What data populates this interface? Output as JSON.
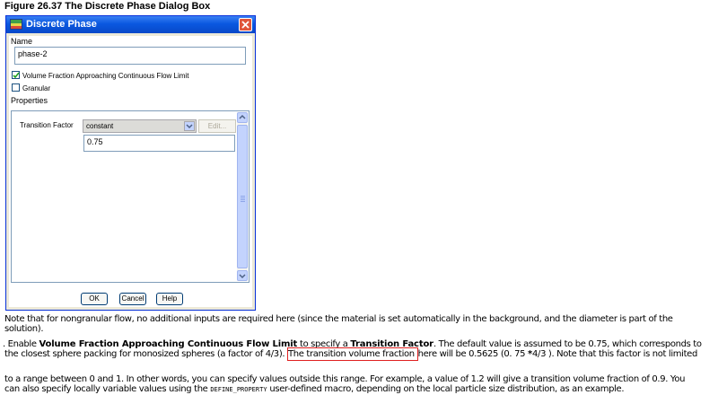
{
  "caption": "Figure 26.37  The Discrete Phase Dialog Box",
  "dialog": {
    "title": "Discrete Phase",
    "name_label": "Name",
    "name_value": "phase-2",
    "vf_checkbox_label": "Volume Fraction Approaching Continuous Flow Limit",
    "vf_checked": true,
    "granular_label": "Granular",
    "granular_checked": false,
    "properties_label": "Properties",
    "transition_factor_label": "Transition Factor",
    "method_value": "constant",
    "edit_label": "Edit...",
    "factor_value": "0.75",
    "ok_label": "OK",
    "cancel_label": "Cancel",
    "help_label": "Help"
  },
  "body": {
    "p1_line1": "Note that for nongranular flow, no additional inputs are required here (since the material is set automatically in the background, and the diameter is part of the",
    "p1_line2": "solution).",
    "p2_prefix": ". Enable ",
    "p2_bold1": "Volume Fraction Approaching Continuous Flow Limit",
    "p2_mid": " to specify a ",
    "p2_bold2": "Transition Factor",
    "p2_rest": ". The default value is assumed to be 0.75, which corresponds to",
    "p2_line2_a": "the closest sphere packing for monosized spheres (a factor of 4/3). ",
    "p2_highlight": "The transition volume fraction ",
    "p2_line2_b": "here will be 0.5625 (0. 75 ",
    "p2_times": "*",
    "p2_line2_c": "4/3 ). Note that this factor is not limited",
    "p3_line1": "to a range between 0 and 1. In other words, you can specify values outside this range. For example, a value of 1.2 will give a transition volume fraction of 0.9. You",
    "p3_line2_a": "can also specify locally variable values using the ",
    "p3_macro": "DEFINE_PROPERTY",
    "p3_line2_b": " user-defined macro, depending on the local particle size distribution, as an example."
  },
  "colors": {
    "titlebar": "#0a58e0",
    "highlight_box": "#e02020",
    "close_button": "#e0553b"
  }
}
